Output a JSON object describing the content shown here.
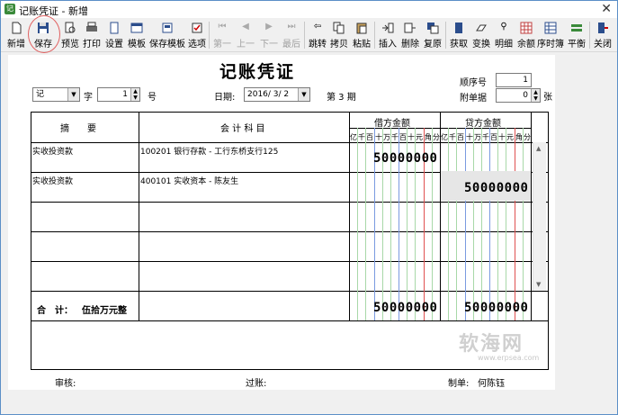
{
  "window": {
    "title": "记账凭证 - 新增",
    "close_glyph": "✕"
  },
  "toolbar": {
    "buttons": [
      {
        "label": "新增"
      },
      {
        "label": "保存"
      },
      {
        "label": "预览"
      },
      {
        "label": "打印"
      },
      {
        "label": "设置"
      },
      {
        "label": "模板"
      },
      {
        "label": "保存模板"
      },
      {
        "label": "选项"
      },
      {
        "label": "第一"
      },
      {
        "label": "上一"
      },
      {
        "label": "下一"
      },
      {
        "label": "最后"
      },
      {
        "label": "跳转"
      },
      {
        "label": "拷贝"
      },
      {
        "label": "粘贴"
      },
      {
        "label": "插入"
      },
      {
        "label": "删除"
      },
      {
        "label": "复原"
      },
      {
        "label": "获取"
      },
      {
        "label": "变换"
      },
      {
        "label": "明细"
      },
      {
        "label": "余额"
      },
      {
        "label": "序时簿"
      },
      {
        "label": "平衡"
      },
      {
        "label": "关闭"
      }
    ]
  },
  "voucher": {
    "title": "记账凭证",
    "word_label": "字",
    "word_value": "记",
    "number_value": "1",
    "number_label": "号",
    "date_label": "日期:",
    "date_value": "2016/ 3/ 2",
    "period_text": "第 3 期",
    "seq_label": "顺序号",
    "seq_value": "1",
    "attach_label": "附单据",
    "attach_value": "0",
    "attach_unit": "张"
  },
  "table": {
    "col_summary": "摘　　要",
    "col_account": "会 计 科 目",
    "col_debit": "借方金额",
    "col_credit": "贷方金额",
    "digit_headers": [
      "亿",
      "千",
      "百",
      "十",
      "万",
      "千",
      "百",
      "十",
      "元",
      "角",
      "分"
    ],
    "rows": [
      {
        "summary": "实收投资款",
        "account": "100201 银行存款 - 工行东桥支行125",
        "debit": "50000000",
        "credit": ""
      },
      {
        "summary": "实收投资款",
        "account": "400101 实收资本 - 陈友生",
        "debit": "",
        "credit": "50000000"
      },
      {
        "summary": "",
        "account": "",
        "debit": "",
        "credit": ""
      },
      {
        "summary": "",
        "account": "",
        "debit": "",
        "credit": ""
      },
      {
        "summary": "",
        "account": "",
        "debit": "",
        "credit": ""
      }
    ],
    "total_label": "合　计：",
    "total_words": "伍拾万元整",
    "total_debit": "50000000",
    "total_credit": "50000000"
  },
  "footer": {
    "review_label": "审核:",
    "post_label": "过账:",
    "maker_label": "制单:",
    "maker_value": "何陈钰"
  },
  "watermark": {
    "text": "软海网",
    "url": "www.erpsea.com"
  }
}
